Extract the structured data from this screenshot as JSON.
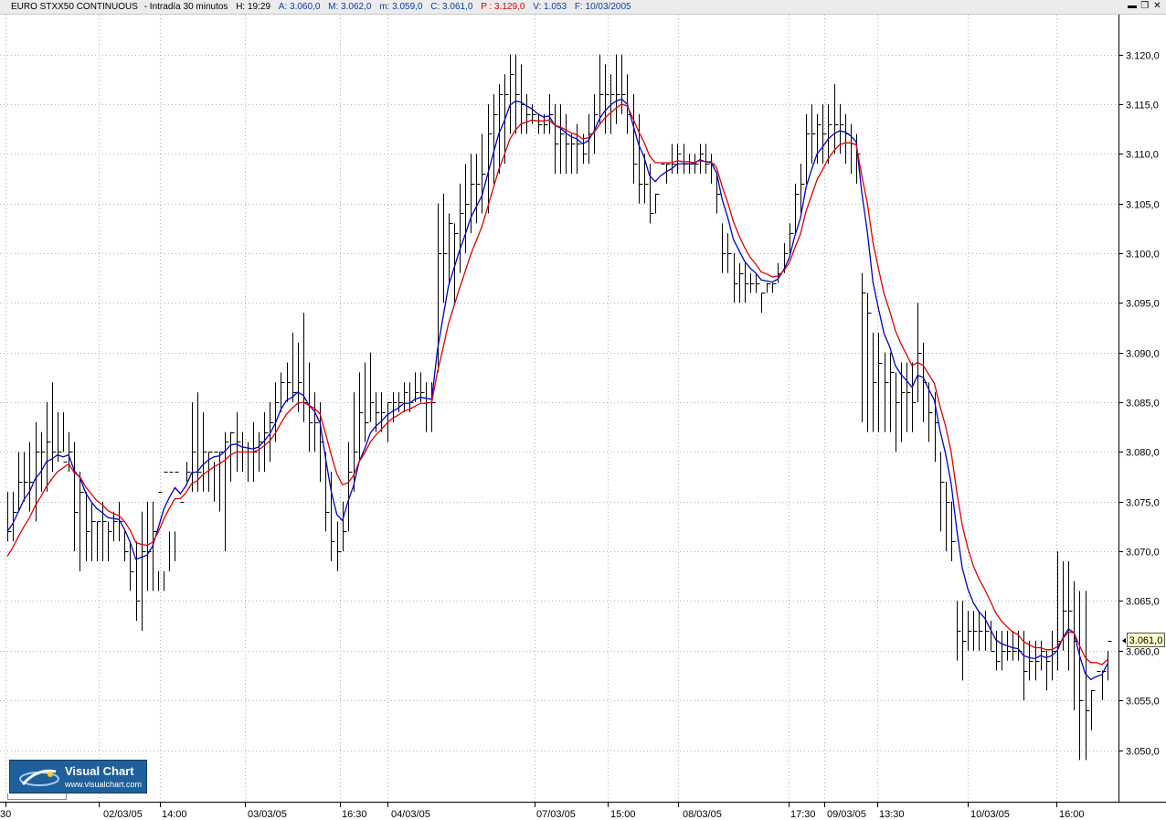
{
  "header": {
    "instrument": "EURO STXX50 CONTINUOUS",
    "interval": "- Intradía 30 minutos",
    "h": "H: 19:29",
    "a": "A: 3.060,0",
    "m": "M: 3.062,0",
    "mn": "m: 3.059,0",
    "c": "C: 3.061,0",
    "p": "P : 3.129,0",
    "v": "V: 1.053",
    "f": "F: 10/03/2005"
  },
  "window_buttons": {
    "minimize": "▬",
    "restore": "❐",
    "close": "✕"
  },
  "last_price_tag": "3.061,0",
  "logo": {
    "title": "Visual Chart",
    "url": "www.visualchart.com"
  },
  "colors": {
    "bars": "#000000",
    "fast_ma": "#0000cc",
    "slow_ma": "#e00000",
    "grid": "#b4b4b4",
    "price_tag_bg": "#ffffcc"
  },
  "chart_data": {
    "type": "line",
    "title": "EURO STXX50 CONTINUOUS - Intradía 30 minutos",
    "bar_style": "high-low bars with close ticks",
    "ylim": [
      3045,
      3125
    ],
    "yticks": [
      "3.050,0",
      "3.055,0",
      "3.060,0",
      "3.065,0",
      "3.070,0",
      "3.075,0",
      "3.080,0",
      "3.085,0",
      "3.090,0",
      "3.095,0",
      "3.100,0",
      "3.105,0",
      "3.110,0",
      "3.115,0",
      "3.120,0"
    ],
    "x_labels": [
      "30",
      "02/03/05",
      "14:00",
      "03/03/05",
      "16:30",
      "04/03/05",
      "07/03/05",
      "15:00",
      "08/03/05",
      "17:30",
      "09/03/05",
      "13:30",
      "10/03/05",
      "16:00"
    ],
    "grid": true,
    "bars": {
      "high": [
        3076,
        3076,
        3080,
        3080,
        3081,
        3083,
        3082,
        3085,
        3087,
        3084,
        3084,
        3082,
        3081,
        3078,
        3076,
        3075,
        3073,
        3075,
        3073,
        3074,
        3075,
        3072,
        3071,
        3071,
        3074,
        3075,
        3075,
        3068,
        3068,
        3072,
        3072,
        3074,
        3079,
        3085,
        3086,
        3084,
        3080,
        3079,
        3080,
        3082,
        3082,
        3084,
        3082,
        3081,
        3083,
        3082,
        3084,
        3085,
        3087,
        3088,
        3089,
        3092,
        3091,
        3094,
        3089,
        3086,
        3085,
        3080,
        3078,
        3073,
        3075,
        3081,
        3086,
        3088,
        3089,
        3090,
        3086,
        3086,
        3085,
        3086,
        3086,
        3087,
        3087,
        3088,
        3088,
        3087,
        3087,
        3105,
        3106,
        3104,
        3103,
        3107,
        3109,
        3110,
        3110,
        3112,
        3115,
        3116,
        3117,
        3118,
        3120,
        3120,
        3119,
        3116,
        3115,
        3114,
        3114,
        3116,
        3115,
        3115,
        3114,
        3112,
        3113,
        3112,
        3114,
        3116,
        3120,
        3119,
        3118,
        3120,
        3120,
        3118,
        3116,
        3114,
        3110,
        3109,
        3106,
        3107,
        3109,
        3111,
        3111,
        3111,
        3110,
        3110,
        3111,
        3111,
        3110,
        3108,
        3103,
        3102,
        3100,
        3099,
        3099,
        3098,
        3098,
        3096,
        3097,
        3097,
        3099,
        3101,
        3103,
        3107,
        3109,
        3114,
        3115,
        3114,
        3115,
        3115,
        3117,
        3115,
        3114,
        3113,
        3112,
        3098,
        3096,
        3092,
        3092,
        3090,
        3090,
        3088,
        3089,
        3089,
        3089,
        3095,
        3091,
        3087,
        3086,
        3080,
        3077,
        3075,
        3065,
        3065,
        3064,
        3064,
        3064,
        3064,
        3063,
        3062,
        3062,
        3062,
        3062,
        3062,
        3062,
        3061,
        3061,
        3061,
        3060,
        3062,
        3070,
        3069,
        3069,
        3067,
        3066,
        3066,
        3056,
        3056,
        3058,
        3060,
        3062
      ],
      "low": [
        3071,
        3071,
        3074,
        3075,
        3074,
        3073,
        3076,
        3076,
        3078,
        3079,
        3080,
        3078,
        3070,
        3068,
        3069,
        3069,
        3069,
        3069,
        3069,
        3071,
        3071,
        3069,
        3066,
        3063,
        3062,
        3066,
        3066,
        3066,
        3066,
        3068,
        3069,
        3074,
        3077,
        3076,
        3076,
        3076,
        3076,
        3075,
        3074,
        3070,
        3077,
        3078,
        3078,
        3077,
        3077,
        3078,
        3078,
        3079,
        3081,
        3084,
        3085,
        3085,
        3084,
        3083,
        3080,
        3080,
        3077,
        3072,
        3069,
        3068,
        3070,
        3072,
        3076,
        3079,
        3081,
        3083,
        3082,
        3082,
        3081,
        3083,
        3084,
        3084,
        3084,
        3085,
        3085,
        3082,
        3082,
        3088,
        3095,
        3097,
        3095,
        3098,
        3100,
        3102,
        3103,
        3104,
        3104,
        3107,
        3108,
        3109,
        3112,
        3112,
        3112,
        3112,
        3113,
        3112,
        3112,
        3112,
        3108,
        3108,
        3108,
        3108,
        3108,
        3109,
        3109,
        3110,
        3113,
        3112,
        3112,
        3113,
        3114,
        3112,
        3107,
        3105,
        3105,
        3103,
        3104,
        3107,
        3107,
        3108,
        3108,
        3108,
        3108,
        3108,
        3108,
        3108,
        3107,
        3104,
        3098,
        3098,
        3095,
        3095,
        3095,
        3096,
        3096,
        3094,
        3096,
        3096,
        3097,
        3098,
        3100,
        3102,
        3104,
        3107,
        3109,
        3109,
        3109,
        3109,
        3110,
        3110,
        3109,
        3108,
        3107,
        3083,
        3082,
        3082,
        3082,
        3082,
        3082,
        3080,
        3081,
        3082,
        3082,
        3085,
        3083,
        3081,
        3079,
        3072,
        3070,
        3069,
        3059,
        3057,
        3060,
        3060,
        3060,
        3060,
        3060,
        3058,
        3058,
        3059,
        3059,
        3059,
        3055,
        3057,
        3057,
        3058,
        3056,
        3057,
        3058,
        3060,
        3058,
        3054,
        3049,
        3049,
        3052,
        3056,
        3055,
        3057,
        3059
      ],
      "close": [
        3072,
        3074,
        3077,
        3077,
        3077,
        3080,
        3080,
        3081,
        3080,
        3080,
        3079,
        3080,
        3074,
        3076,
        3072,
        3073,
        3073,
        3073,
        3072,
        3073,
        3073,
        3070,
        3068,
        3065,
        3070,
        3070,
        3072,
        3076,
        3078,
        3078,
        3078,
        3075,
        3078,
        3080,
        3078,
        3080,
        3080,
        3080,
        3080,
        3081,
        3082,
        3081,
        3080,
        3080,
        3080,
        3081,
        3082,
        3083,
        3085,
        3087,
        3087,
        3086,
        3087,
        3085,
        3083,
        3083,
        3081,
        3074,
        3071,
        3070,
        3072,
        3078,
        3080,
        3084,
        3083,
        3085,
        3084,
        3084,
        3085,
        3085,
        3085,
        3086,
        3085,
        3086,
        3086,
        3085,
        3085,
        3100,
        3100,
        3103,
        3102,
        3104,
        3105,
        3107,
        3107,
        3108,
        3112,
        3114,
        3116,
        3116,
        3118,
        3116,
        3115,
        3114,
        3114,
        3113,
        3113,
        3114,
        3111,
        3112,
        3111,
        3111,
        3111,
        3110,
        3112,
        3114,
        3116,
        3116,
        3116,
        3116,
        3116,
        3114,
        3109,
        3107,
        3107,
        3104,
        3106,
        3109,
        3109,
        3109,
        3110,
        3109,
        3109,
        3109,
        3110,
        3109,
        3109,
        3106,
        3100,
        3100,
        3097,
        3098,
        3097,
        3097,
        3097,
        3096,
        3097,
        3097,
        3098,
        3100,
        3102,
        3106,
        3107,
        3112,
        3112,
        3113,
        3112,
        3113,
        3113,
        3113,
        3112,
        3111,
        3110,
        3096,
        3094,
        3087,
        3089,
        3087,
        3088,
        3085,
        3086,
        3086,
        3085,
        3090,
        3087,
        3084,
        3083,
        3077,
        3075,
        3071,
        3062,
        3061,
        3062,
        3062,
        3062,
        3062,
        3060,
        3059,
        3060,
        3060,
        3060,
        3060,
        3058,
        3059,
        3059,
        3060,
        3059,
        3060,
        3061,
        3064,
        3064,
        3061,
        3055,
        3054,
        3056,
        3058,
        3058,
        3061
      ]
    },
    "series": [
      {
        "color": "blue",
        "values": [
          3072,
          3072.8,
          3074.0,
          3075.2,
          3076.0,
          3077.3,
          3078.0,
          3079.0,
          3079.3,
          3079.7,
          3079.5,
          3079.7,
          3078.1,
          3077.4,
          3075.9,
          3075.0,
          3074.3,
          3073.9,
          3073.4,
          3073.3,
          3073.2,
          3072.2,
          3070.9,
          3069.2,
          3069.4,
          3069.6,
          3070.5,
          3072.3,
          3074.2,
          3075.4,
          3076.4,
          3075.8,
          3076.6,
          3077.9,
          3078.0,
          3078.7,
          3079.2,
          3079.5,
          3079.6,
          3080.1,
          3080.7,
          3080.8,
          3080.5,
          3080.4,
          3080.3,
          3080.5,
          3081.1,
          3081.8,
          3082.9,
          3084.3,
          3085.2,
          3085.5,
          3086.0,
          3085.7,
          3084.7,
          3084.1,
          3082.9,
          3079.3,
          3076.0,
          3073.7,
          3073.1,
          3075.0,
          3076.6,
          3079.0,
          3080.3,
          3081.9,
          3082.6,
          3083.1,
          3083.7,
          3084.1,
          3084.4,
          3084.9,
          3084.9,
          3085.3,
          3085.5,
          3085.4,
          3085.3,
          3090.2,
          3093.5,
          3096.7,
          3098.5,
          3100.3,
          3101.9,
          3103.6,
          3104.7,
          3105.8,
          3107.9,
          3110.0,
          3112.0,
          3113.3,
          3114.9,
          3115.3,
          3115.2,
          3114.8,
          3114.5,
          3114.0,
          3113.7,
          3113.8,
          3112.9,
          3112.6,
          3112.1,
          3111.7,
          3111.5,
          3111.0,
          3111.3,
          3112.2,
          3113.5,
          3114.3,
          3114.9,
          3115.3,
          3115.5,
          3115.0,
          3113.0,
          3111.0,
          3109.7,
          3107.8,
          3107.2,
          3107.8,
          3108.2,
          3108.5,
          3109.0,
          3109.0,
          3109.0,
          3109.0,
          3109.4,
          3109.2,
          3109.1,
          3108.1,
          3105.4,
          3103.6,
          3101.4,
          3100.3,
          3099.2,
          3098.5,
          3098.0,
          3097.3,
          3097.2,
          3097.1,
          3097.4,
          3098.3,
          3099.5,
          3101.7,
          3103.5,
          3106.6,
          3108.4,
          3110.0,
          3110.7,
          3111.5,
          3112.0,
          3112.3,
          3112.2,
          3111.8,
          3111.2,
          3106.1,
          3102.1,
          3097.1,
          3094.4,
          3091.9,
          3090.6,
          3088.7,
          3087.8,
          3087.2,
          3086.5,
          3087.7,
          3087.5,
          3086.3,
          3085.2,
          3082.2,
          3079.8,
          3076.8,
          3072.2,
          3068.3,
          3066.2,
          3064.8,
          3063.9,
          3063.3,
          3062.2,
          3061.1,
          3060.7,
          3060.5,
          3060.3,
          3060.2,
          3059.5,
          3059.3,
          3059.2,
          3059.5,
          3059.3,
          3059.5,
          3060.0,
          3061.3,
          3062.2,
          3061.8,
          3059.5,
          3057.7,
          3057.1,
          3057.4,
          3057.6,
          3058.7
        ]
      },
      {
        "color": "red",
        "values": [
          3069.5,
          3070.4,
          3071.5,
          3072.5,
          3073.4,
          3074.6,
          3075.5,
          3076.5,
          3077.3,
          3078.0,
          3078.4,
          3078.8,
          3077.9,
          3077.5,
          3076.5,
          3075.8,
          3075.1,
          3074.7,
          3074.1,
          3073.8,
          3073.6,
          3073.0,
          3072.1,
          3070.9,
          3070.7,
          3070.6,
          3070.9,
          3071.9,
          3073.2,
          3074.3,
          3075.3,
          3075.3,
          3075.9,
          3076.8,
          3077.1,
          3077.7,
          3078.1,
          3078.5,
          3078.8,
          3079.2,
          3079.7,
          3080.0,
          3080.0,
          3080.0,
          3080.0,
          3080.2,
          3080.6,
          3081.1,
          3081.9,
          3082.9,
          3083.8,
          3084.4,
          3084.9,
          3085.0,
          3084.7,
          3084.4,
          3083.8,
          3081.8,
          3079.7,
          3077.8,
          3076.7,
          3076.9,
          3077.6,
          3079.0,
          3079.9,
          3081.0,
          3081.7,
          3082.3,
          3082.9,
          3083.4,
          3083.7,
          3084.1,
          3084.3,
          3084.6,
          3084.9,
          3084.9,
          3085.0,
          3088.0,
          3090.4,
          3092.9,
          3094.7,
          3096.5,
          3098.2,
          3099.9,
          3101.3,
          3102.7,
          3104.6,
          3106.5,
          3108.4,
          3109.9,
          3111.5,
          3112.4,
          3113.0,
          3113.2,
          3113.4,
          3113.3,
          3113.3,
          3113.4,
          3112.9,
          3112.7,
          3112.4,
          3112.1,
          3111.9,
          3111.5,
          3111.6,
          3112.1,
          3112.9,
          3113.6,
          3114.1,
          3114.6,
          3115.0,
          3114.8,
          3113.6,
          3112.3,
          3111.2,
          3109.8,
          3109.1,
          3109.1,
          3109.1,
          3109.1,
          3109.3,
          3109.2,
          3109.2,
          3109.1,
          3109.3,
          3109.2,
          3109.2,
          3108.6,
          3106.7,
          3105.1,
          3103.2,
          3101.8,
          3100.6,
          3099.6,
          3098.9,
          3098.1,
          3097.9,
          3097.6,
          3097.7,
          3098.2,
          3099.0,
          3100.5,
          3101.9,
          3104.2,
          3105.8,
          3107.4,
          3108.4,
          3109.5,
          3110.3,
          3110.9,
          3111.1,
          3111.1,
          3110.9,
          3107.8,
          3105.0,
          3101.1,
          3098.4,
          3095.9,
          3094.2,
          3092.2,
          3090.9,
          3089.8,
          3088.7,
          3089.0,
          3088.7,
          3087.8,
          3086.9,
          3084.6,
          3082.6,
          3080.0,
          3076.0,
          3072.6,
          3070.3,
          3068.5,
          3067.2,
          3066.2,
          3065.0,
          3063.8,
          3063.0,
          3062.4,
          3061.9,
          3061.6,
          3060.9,
          3060.6,
          3060.3,
          3060.3,
          3060.1,
          3060.1,
          3060.4,
          3061.2,
          3061.9,
          3061.8,
          3060.5,
          3059.3,
          3058.8,
          3058.8,
          3058.6,
          3059.1
        ]
      }
    ]
  }
}
